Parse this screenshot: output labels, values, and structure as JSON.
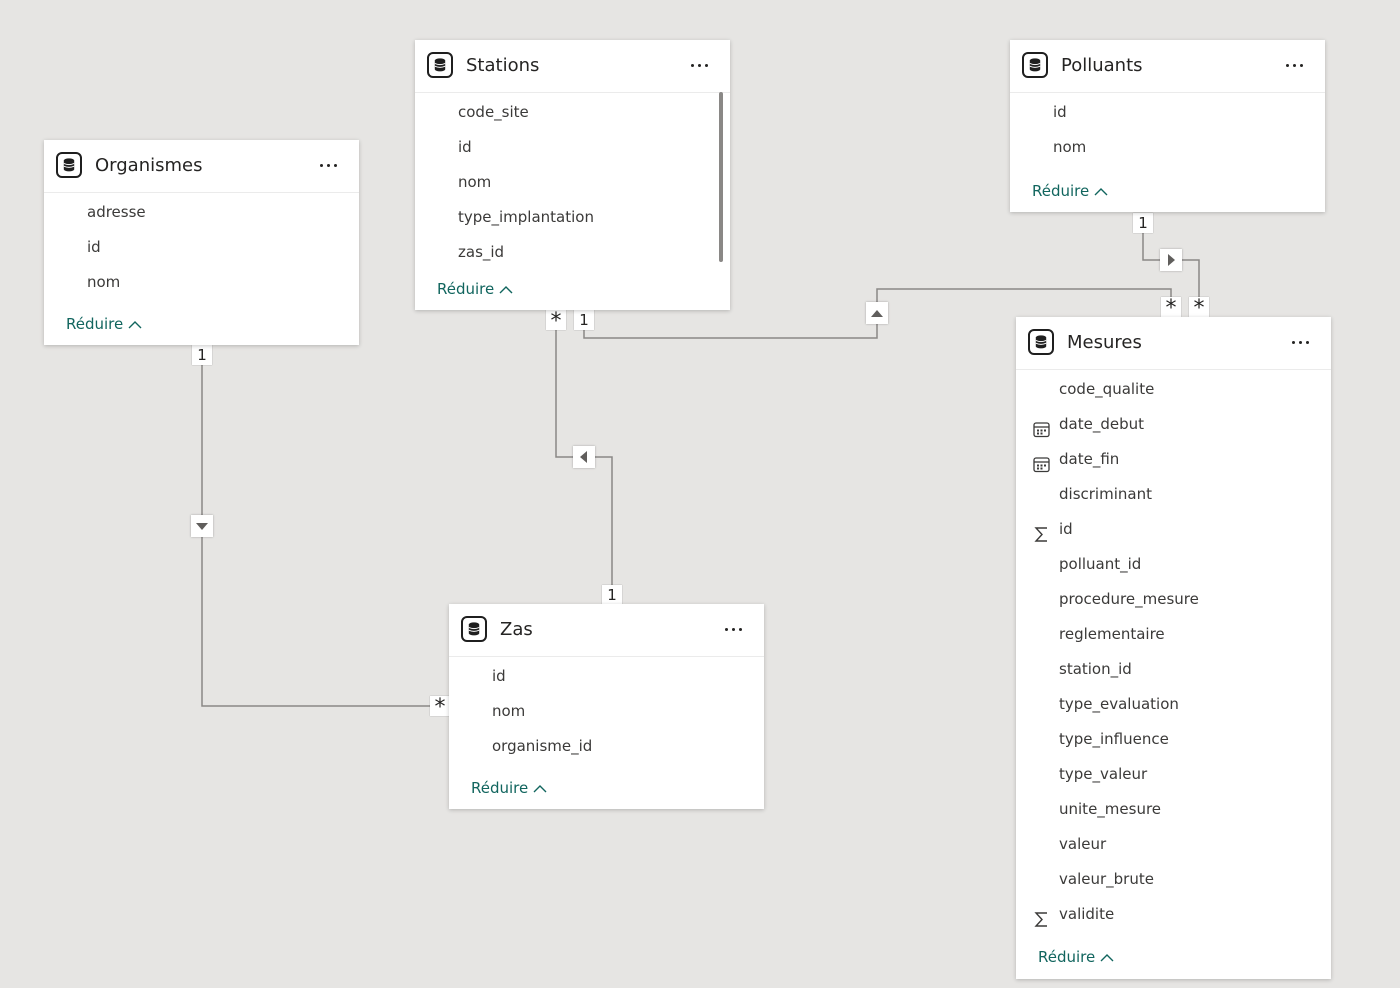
{
  "tables": {
    "organismes": {
      "title": "Organismes",
      "fields": [
        "adresse",
        "id",
        "nom"
      ],
      "collapse_label": "Réduire"
    },
    "stations": {
      "title": "Stations",
      "fields": [
        "code_site",
        "id",
        "nom",
        "type_implantation",
        "zas_id"
      ],
      "collapse_label": "Réduire"
    },
    "polluants": {
      "title": "Polluants",
      "fields": [
        "id",
        "nom"
      ],
      "collapse_label": "Réduire"
    },
    "zas": {
      "title": "Zas",
      "fields": [
        "id",
        "nom",
        "organisme_id"
      ],
      "collapse_label": "Réduire"
    },
    "mesures": {
      "title": "Mesures",
      "fields": [
        {
          "name": "code_qualite",
          "icon": ""
        },
        {
          "name": "date_debut",
          "icon": "calendar-icon"
        },
        {
          "name": "date_fin",
          "icon": "calendar-icon"
        },
        {
          "name": "discriminant",
          "icon": ""
        },
        {
          "name": "id",
          "icon": "sigma-icon"
        },
        {
          "name": "polluant_id",
          "icon": ""
        },
        {
          "name": "procedure_mesure",
          "icon": ""
        },
        {
          "name": "reglementaire",
          "icon": ""
        },
        {
          "name": "station_id",
          "icon": ""
        },
        {
          "name": "type_evaluation",
          "icon": ""
        },
        {
          "name": "type_influence",
          "icon": ""
        },
        {
          "name": "type_valeur",
          "icon": ""
        },
        {
          "name": "unite_mesure",
          "icon": ""
        },
        {
          "name": "valeur",
          "icon": ""
        },
        {
          "name": "valeur_brute",
          "icon": ""
        },
        {
          "name": "validite",
          "icon": "sigma-icon"
        }
      ],
      "collapse_label": "Réduire"
    }
  },
  "relationships": [
    {
      "from": "Organismes",
      "to": "Zas",
      "from_cardinality": "1",
      "to_cardinality": "*"
    },
    {
      "from": "Zas",
      "to": "Stations",
      "from_cardinality": "1",
      "to_cardinality": "*"
    },
    {
      "from": "Stations",
      "to": "Mesures",
      "from_cardinality": "1",
      "to_cardinality": "*"
    },
    {
      "from": "Polluants",
      "to": "Mesures",
      "from_cardinality": "1",
      "to_cardinality": "*"
    }
  ],
  "colors": {
    "canvas_background": "#e6e5e3",
    "card_background": "#ffffff",
    "collapse_link": "#11655e",
    "relationship_line": "#8a8886"
  }
}
